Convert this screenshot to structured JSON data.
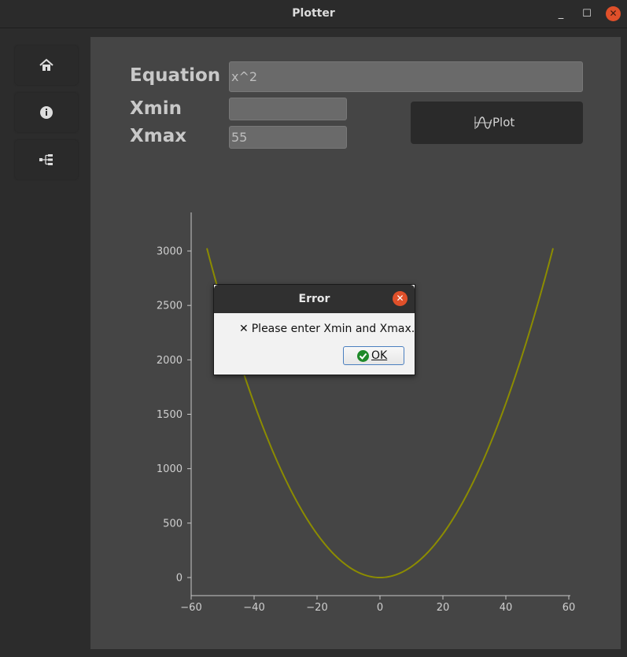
{
  "window": {
    "title": "Plotter"
  },
  "sidebar": {
    "items": [
      {
        "name": "home",
        "icon": "home-icon"
      },
      {
        "name": "info",
        "icon": "info-icon"
      },
      {
        "name": "tree",
        "icon": "tree-icon"
      }
    ]
  },
  "form": {
    "equation_label": "Equation",
    "equation_value": "x^2",
    "xmin_label": "Xmin",
    "xmin_value": "",
    "xmax_label": "Xmax",
    "xmax_value": "55",
    "plot_label": "Plot"
  },
  "dialog": {
    "title": "Error",
    "message": "Please enter Xmin and Xmax.",
    "ok_label": "OK"
  },
  "colors": {
    "background": "#2c2c2c",
    "panel": "#454545",
    "curve": "#8c8c00",
    "close": "#e0502a",
    "ok_icon": "#1f8a2a"
  },
  "chart_data": {
    "type": "line",
    "title": "",
    "xlabel": "",
    "ylabel": "",
    "xlim": [
      -60,
      60
    ],
    "ylim": [
      0,
      3300
    ],
    "xticks": [
      -60,
      -40,
      -20,
      0,
      20,
      40,
      60
    ],
    "xtick_labels": [
      "−60",
      "−40",
      "−20",
      "0",
      "20",
      "40",
      "60"
    ],
    "yticks": [
      0,
      500,
      1000,
      1500,
      2000,
      2500,
      3000
    ],
    "yticks_labels": [
      "0",
      "500",
      "1000",
      "1500",
      "2000",
      "2500",
      "3000"
    ],
    "grid": false,
    "series": [
      {
        "function": "x^2",
        "x_range": [
          -55,
          55
        ]
      }
    ]
  }
}
